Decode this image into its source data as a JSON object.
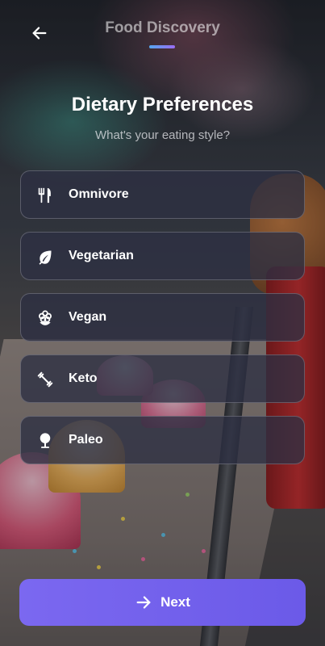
{
  "header": {
    "app_title": "Food Discovery",
    "back_icon": "arrow-left-icon",
    "progress_fraction": 0.2
  },
  "intro": {
    "title": "Dietary Preferences",
    "subtitle": "What's your eating style?"
  },
  "options": [
    {
      "label": "Omnivore",
      "icon": "fork-knife-icon"
    },
    {
      "label": "Vegetarian",
      "icon": "leaf-icon"
    },
    {
      "label": "Vegan",
      "icon": "flower-icon"
    },
    {
      "label": "Keto",
      "icon": "dumbbell-icon"
    },
    {
      "label": "Paleo",
      "icon": "tree-icon"
    }
  ],
  "footer": {
    "next_label": "Next",
    "next_icon": "arrow-right-icon"
  },
  "colors": {
    "accent": "#7066ee",
    "progress_start": "#55a7f0",
    "progress_end": "#9a6cf2"
  }
}
